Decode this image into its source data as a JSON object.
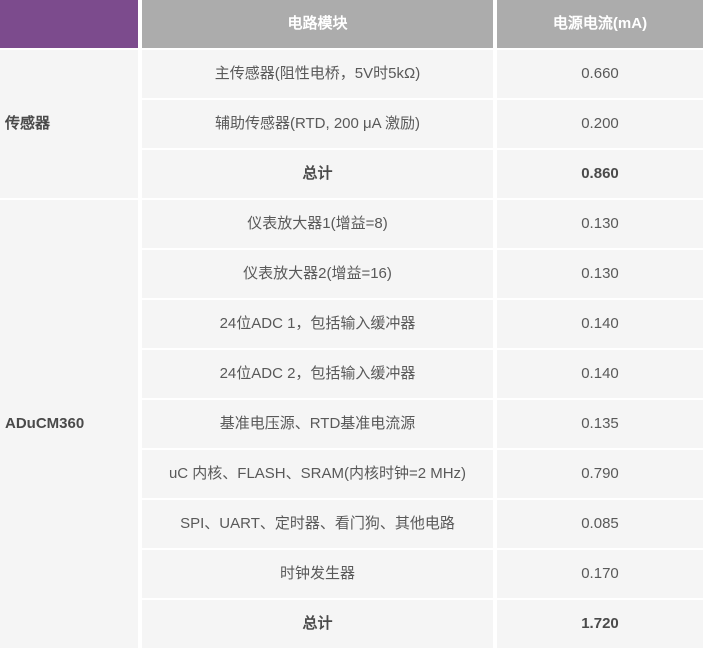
{
  "colors": {
    "corner_purple": "#7C4B8D",
    "header_grey": "#ACACAC",
    "row_bg": "#F5F5F5",
    "text_grey": "#595959",
    "text_bold": "#4A4A4A"
  },
  "table": {
    "header": {
      "module_label": "电路模块",
      "current_label": "电源电流(mA)"
    },
    "groups": [
      {
        "name": "传感器",
        "rows": [
          {
            "module": "主传感器(阻性电桥，5V时5kΩ)",
            "current": "0.660",
            "bold": false
          },
          {
            "module": "辅助传感器(RTD, 200 μA 激励)",
            "current": "0.200",
            "bold": false
          },
          {
            "module": "总计",
            "current": "0.860",
            "bold": true
          }
        ]
      },
      {
        "name": "ADuCM360",
        "rows": [
          {
            "module": "仪表放大器1(增益=8)",
            "current": "0.130",
            "bold": false
          },
          {
            "module": "仪表放大器2(增益=16)",
            "current": "0.130",
            "bold": false
          },
          {
            "module": "24位ADC 1，包括输入缓冲器",
            "current": "0.140",
            "bold": false
          },
          {
            "module": "24位ADC 2，包括输入缓冲器",
            "current": "0.140",
            "bold": false
          },
          {
            "module": "基准电压源、RTD基准电流源",
            "current": "0.135",
            "bold": false
          },
          {
            "module": "uC 内核、FLASH、SRAM(内核时钟=2 MHz)",
            "current": "0.790",
            "bold": false
          },
          {
            "module": "SPI、UART、定时器、看门狗、其他电路",
            "current": "0.085",
            "bold": false
          },
          {
            "module": "时钟发生器",
            "current": "0.170",
            "bold": false
          },
          {
            "module": "总计",
            "current": "1.720",
            "bold": true
          }
        ]
      }
    ]
  },
  "chart_data": {
    "type": "table",
    "columns": [
      "",
      "电路模块",
      "电源电流(mA)"
    ],
    "rows": [
      [
        "传感器",
        "主传感器(阻性电桥，5V时5kΩ)",
        0.66
      ],
      [
        "传感器",
        "辅助传感器(RTD, 200 μA 激励)",
        0.2
      ],
      [
        "传感器",
        "总计",
        0.86
      ],
      [
        "ADuCM360",
        "仪表放大器1(增益=8)",
        0.13
      ],
      [
        "ADuCM360",
        "仪表放大器2(增益=16)",
        0.13
      ],
      [
        "ADuCM360",
        "24位ADC 1，包括输入缓冲器",
        0.14
      ],
      [
        "ADuCM360",
        "24位ADC 2，包括输入缓冲器",
        0.14
      ],
      [
        "ADuCM360",
        "基准电压源、RTD基准电流源",
        0.135
      ],
      [
        "ADuCM360",
        "uC 内核、FLASH、SRAM(内核时钟=2 MHz)",
        0.79
      ],
      [
        "ADuCM360",
        "SPI、UART、定时器、看门狗、其他电路",
        0.085
      ],
      [
        "ADuCM360",
        "时钟发生器",
        0.17
      ],
      [
        "ADuCM360",
        "总计",
        1.72
      ]
    ]
  }
}
